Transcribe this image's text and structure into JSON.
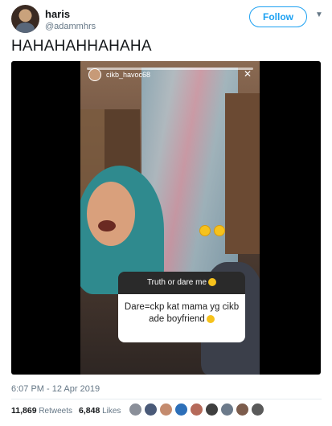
{
  "author": {
    "name": "haris",
    "handle": "@adammhrs",
    "avatar_icon": "profile-photo"
  },
  "follow_label": "Follow",
  "caret_icon": "chevron-down-icon",
  "tweet": {
    "text": "HAHAHAHHAHAHA"
  },
  "story": {
    "username": "cikb_havoc68",
    "question_header": "Truth or dare me",
    "answer_line1": "Dare=ckp kat mama yg cikb",
    "answer_line2": "ade boyfriend"
  },
  "meta": {
    "timestamp": "6:07 PM - 12 Apr 2019",
    "retweets_count": "11,869",
    "retweets_label": "Retweets",
    "likes_count": "6,848",
    "likes_label": "Likes"
  },
  "colors": {
    "accent": "#1da1f2",
    "muted": "#657786"
  },
  "liker_colors": [
    "#8a8f99",
    "#4a5a78",
    "#c48b6e",
    "#2d6fb8",
    "#b56a5a",
    "#3f3f3f",
    "#6c7a8a",
    "#7c5c4c",
    "#5a5a5a"
  ]
}
